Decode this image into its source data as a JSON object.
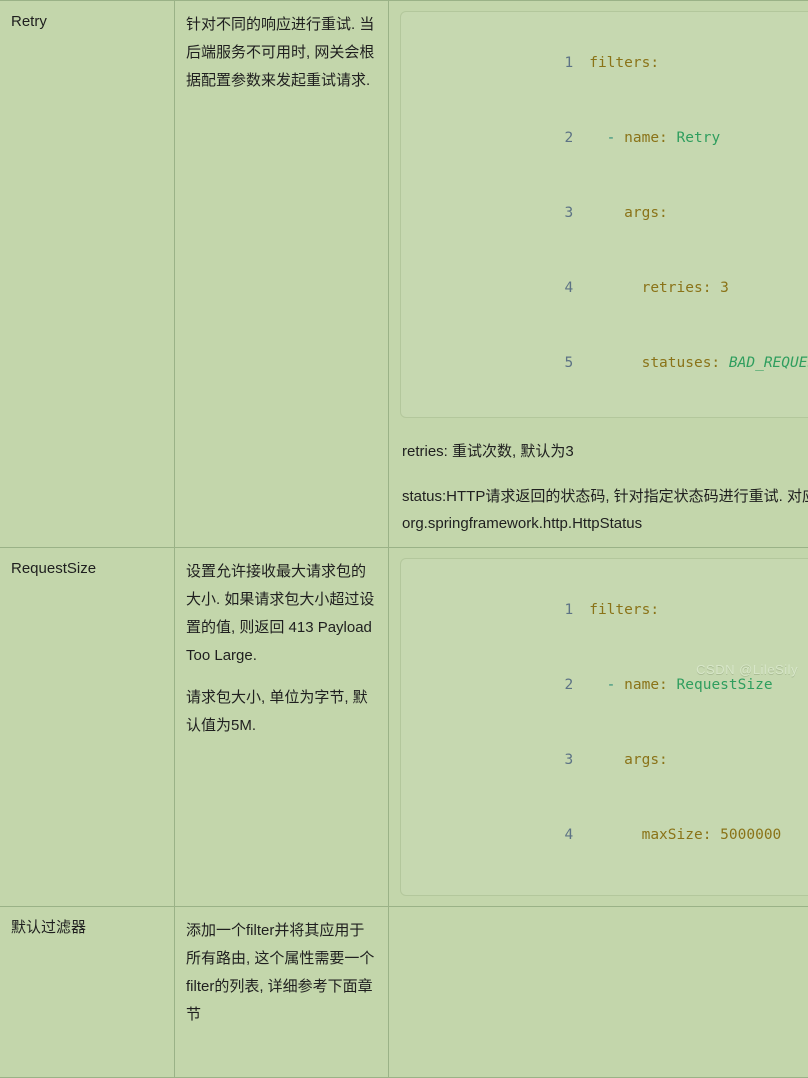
{
  "table": {
    "rows": [
      {
        "name": "Retry",
        "description_paragraphs": [
          "针对不同的响应进行重试. 当后端服务不可用时, 网关会根据配置参数来发起重试请求."
        ],
        "code": {
          "lines": [
            {
              "num": "1",
              "segments": [
                {
                  "text": "filters:",
                  "style": "k"
                }
              ]
            },
            {
              "num": "2",
              "segments": [
                {
                  "text": "  - ",
                  "style": "dash"
                },
                {
                  "text": "name: ",
                  "style": "k"
                },
                {
                  "text": "Retry",
                  "style": "val"
                }
              ]
            },
            {
              "num": "3",
              "segments": [
                {
                  "text": "    args:",
                  "style": "k"
                }
              ]
            },
            {
              "num": "4",
              "segments": [
                {
                  "text": "      retries: 3",
                  "style": "k"
                }
              ]
            },
            {
              "num": "5",
              "segments": [
                {
                  "text": "      statuses: ",
                  "style": "k"
                },
                {
                  "text": "BAD_REQUEST",
                  "style": "valit"
                }
              ]
            }
          ]
        },
        "notes": [
          "retries: 重试次数, 默认为3",
          "status:HTTP请求返回的状态码, 针对指定状态码进行重试. 对应 org.springframework.http.HttpStatus"
        ]
      },
      {
        "name": "RequestSize",
        "description_paragraphs": [
          "设置允许接收最大请求包的大小. 如果请求包大小超过设置的值, 则返回 413 Payload Too Large.",
          "请求包大小, 单位为字节, 默认值为5M."
        ],
        "code": {
          "lines": [
            {
              "num": "1",
              "segments": [
                {
                  "text": "filters:",
                  "style": "k"
                }
              ]
            },
            {
              "num": "2",
              "segments": [
                {
                  "text": "  - ",
                  "style": "dash"
                },
                {
                  "text": "name: ",
                  "style": "k"
                },
                {
                  "text": "RequestSize",
                  "style": "val"
                }
              ]
            },
            {
              "num": "3",
              "segments": [
                {
                  "text": "    args:",
                  "style": "k"
                }
              ]
            },
            {
              "num": "4",
              "segments": [
                {
                  "text": "      maxSize: 5000000",
                  "style": "k"
                }
              ]
            }
          ]
        },
        "notes": []
      },
      {
        "name": "默认过滤器",
        "description_paragraphs": [
          "添加一个filter并将其应用于所有路由, 这个属性需要一个filter的列表, 详细参考下面章节"
        ],
        "code": {
          "lines": []
        },
        "notes": []
      }
    ]
  },
  "watermark": "CSDN @LileSily"
}
